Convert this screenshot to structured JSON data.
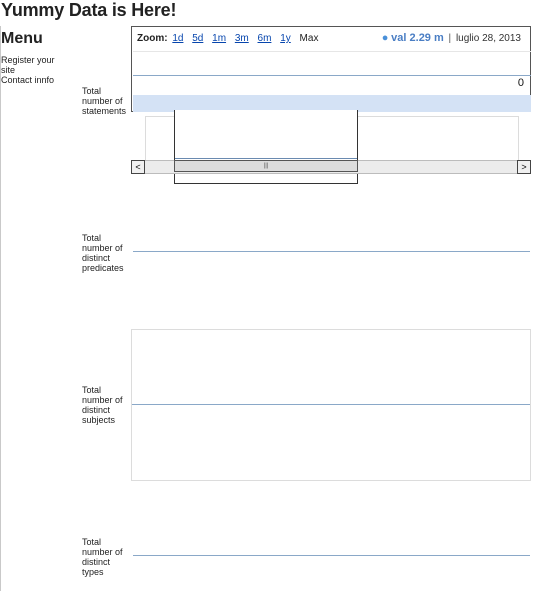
{
  "page": {
    "title": "Yummy Data is Here!"
  },
  "menu": {
    "title": "Menu",
    "links": [
      "Register your site",
      "Contact innfo"
    ]
  },
  "rows": [
    {
      "label": "Total number of statements"
    },
    {
      "label": "Total number of distinct predicates"
    },
    {
      "label": "Total number of distinct subjects"
    },
    {
      "label": "Total number of distinct types"
    }
  ],
  "chart1": {
    "zoom_label": "Zoom:",
    "zoom_buttons": [
      "1d",
      "5d",
      "1m",
      "3m",
      "6m",
      "1y",
      "Max"
    ],
    "zoom_selected": "Max",
    "readout_dot": "●",
    "readout_value": "val 2.29 m",
    "readout_date": "luglio 28, 2013",
    "y_tick_label": "0",
    "scroll_left": "<",
    "scroll_right": ">",
    "scroll_grip": "|||"
  },
  "colors": {
    "series_line": "#8aa8c8",
    "selection_band": "#d4e2f5",
    "readout_value": "#4a7ec4",
    "link": "#0645ad"
  }
}
